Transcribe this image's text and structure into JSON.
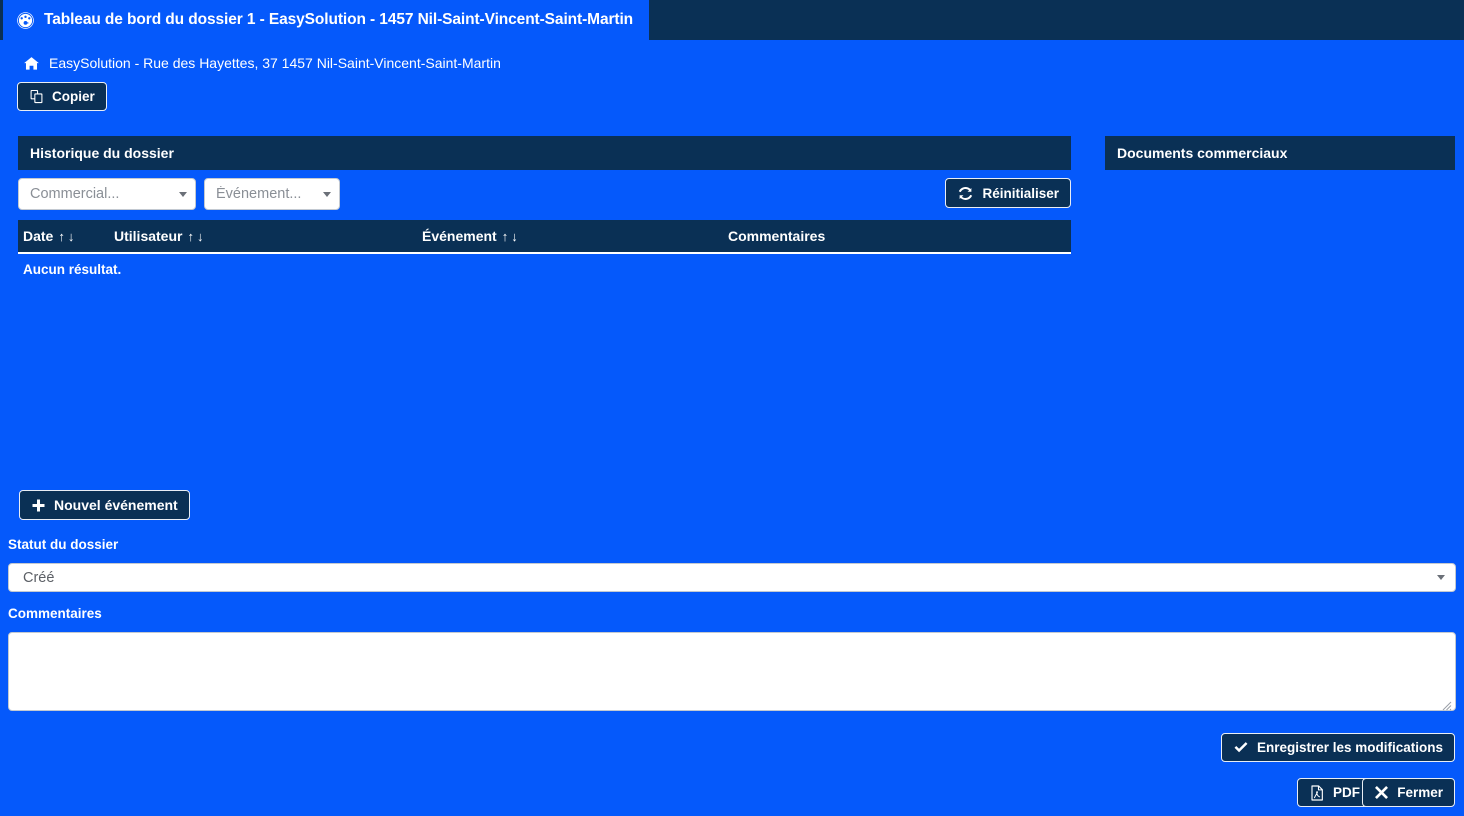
{
  "window": {
    "title": "Tableau de bord du dossier 1 - EasySolution - 1457 Nil-Saint-Vincent-Saint-Martin",
    "title_icon": "dashboard-gauge-icon",
    "titlebar_bg": "#0a3055",
    "tab_bg": "#0559fb"
  },
  "theme": {
    "page_bg": "#0559fb",
    "panel_header_bg": "#0a3055",
    "button_bg": "#0a3055",
    "button_border": "#e9eef5",
    "text_on_blue": "#ffffff",
    "input_bg": "#ffffff",
    "placeholder_color": "#8a8f96"
  },
  "breadcrumb": {
    "icon": "home-icon",
    "text": "EasySolution - Rue des Hayettes, 37 1457 Nil-Saint-Vincent-Saint-Martin"
  },
  "toolbar": {
    "copy_label": "Copier",
    "copy_icon": "copy-icon"
  },
  "history_panel": {
    "title": "Historique du dossier",
    "filters": {
      "commercial_placeholder": "Commercial...",
      "evenement_placeholder": "Événement..."
    },
    "reset_label": "Réinitialiser",
    "reset_icon": "refresh-sync-icon",
    "table": {
      "columns": [
        {
          "label": "Date",
          "sortable": true
        },
        {
          "label": "Utilisateur",
          "sortable": true
        },
        {
          "label": "Événement",
          "sortable": true
        },
        {
          "label": "Commentaires",
          "sortable": false
        }
      ],
      "sort_asc_glyph": "↑",
      "sort_desc_glyph": "↓",
      "rows": [],
      "empty_message": "Aucun résultat."
    },
    "new_event_label": "Nouvel événement",
    "new_event_icon": "plus-icon"
  },
  "documents_panel": {
    "title": "Documents commerciaux",
    "items": []
  },
  "form": {
    "statut_label": "Statut du dossier",
    "statut_value": "Créé",
    "commentaires_label": "Commentaires",
    "commentaires_value": "",
    "commentaires_placeholder": ""
  },
  "footer": {
    "save_label": "Enregistrer les modifications",
    "save_icon": "check-icon",
    "pdf_label": "PDF",
    "pdf_icon": "pdf-file-icon",
    "close_label": "Fermer",
    "close_icon": "times-icon"
  }
}
